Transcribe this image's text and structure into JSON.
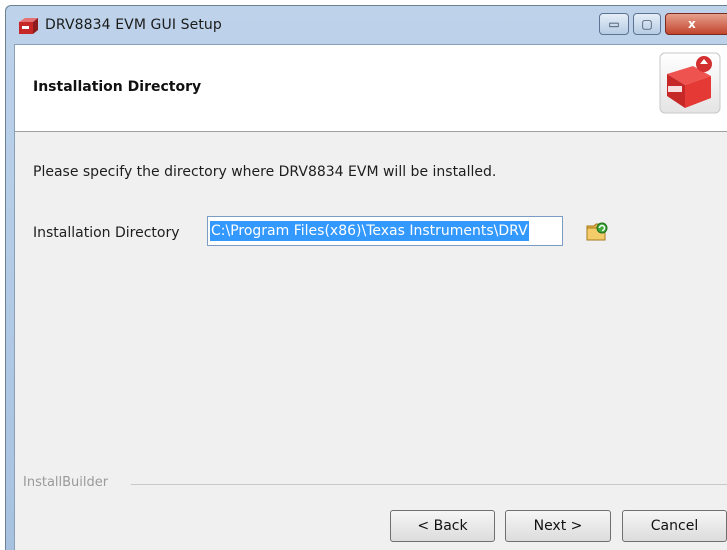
{
  "window": {
    "title": "DRV8834 EVM GUI Setup",
    "controls": {
      "minimize": "▭",
      "maximize": "▢",
      "close": "x"
    }
  },
  "header": {
    "title": "Installation Directory",
    "logo_icon": "installer-box-icon"
  },
  "content": {
    "instruction": "Please specify the directory where DRV8834 EVM will be installed.",
    "directory_label": "Installation Directory",
    "directory_value": "C:\\Program Files(x86)\\Texas Instruments\\DRV",
    "browse_icon": "folder-browse-icon"
  },
  "footer": {
    "brand": "InstallBuilder",
    "back_label": "< Back",
    "next_label": "Next >",
    "cancel_label": "Cancel"
  },
  "colors": {
    "selection": "#3399ff",
    "titlebar": "#bed3ea",
    "close_button": "#c2452e",
    "background": "#f0f0f0"
  }
}
